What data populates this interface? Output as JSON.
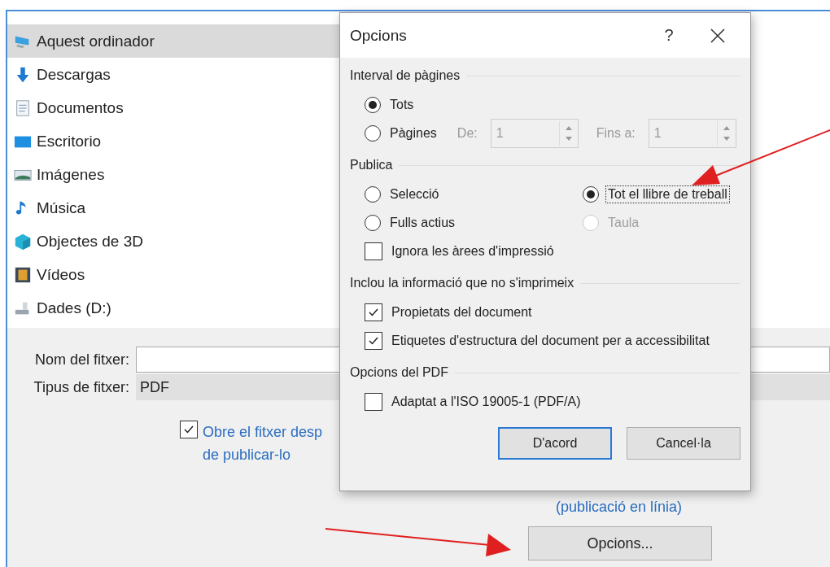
{
  "sidebar": {
    "items": [
      {
        "label": "Aquest ordinador",
        "selected": true
      },
      {
        "label": "Descargas",
        "selected": false
      },
      {
        "label": "Documentos",
        "selected": false
      },
      {
        "label": "Escritorio",
        "selected": false
      },
      {
        "label": "Imágenes",
        "selected": false
      },
      {
        "label": "Música",
        "selected": false
      },
      {
        "label": "Objectes de 3D",
        "selected": false
      },
      {
        "label": "Vídeos",
        "selected": false
      },
      {
        "label": "Dades (D:)",
        "selected": false
      }
    ]
  },
  "save_form": {
    "file_name": {
      "label": "Nom del fitxer:"
    },
    "file_type": {
      "label": "Tipus de fitxer:",
      "value": "PDF"
    },
    "open_after": {
      "lines": [
        "Obre el fitxer desp",
        "de publicar-lo"
      ],
      "checked": true
    },
    "optimize_note": "(publicació en línia)",
    "options_button": "Opcions..."
  },
  "dialog": {
    "title": "Opcions",
    "help": "?",
    "page_range": {
      "title": "Interval de pàgines",
      "options": [
        {
          "label": "Tots",
          "selected": true
        },
        {
          "label": "Pàgines",
          "selected": false
        }
      ],
      "from": {
        "label": "De:",
        "value": "1",
        "disabled": true
      },
      "to": {
        "label": "Fins a:",
        "value": "1",
        "disabled": true
      }
    },
    "publish": {
      "title": "Publica",
      "options": [
        {
          "label": "Selecció",
          "selected": false,
          "disabled": false,
          "focused": false
        },
        {
          "label": "Tot el llibre de treball",
          "selected": true,
          "disabled": false,
          "focused": true
        },
        {
          "label": "Fulls actius",
          "selected": false,
          "disabled": false,
          "focused": false
        },
        {
          "label": "Taula",
          "selected": false,
          "disabled": true,
          "focused": false
        }
      ],
      "ignore_print_areas": {
        "label": "Ignora les àrees d'impressió",
        "checked": false
      }
    },
    "non_printing": {
      "title": "Inclou la informació que no s'imprimeix",
      "checks": [
        {
          "label": "Propietats del document",
          "checked": true
        },
        {
          "label": "Etiquetes d'estructura del document per a accessibilitat",
          "checked": true
        }
      ]
    },
    "pdf_options": {
      "title": "Opcions del PDF",
      "checks": [
        {
          "label": "Adaptat a l'ISO 19005-1 (PDF/A)",
          "checked": false
        }
      ]
    },
    "buttons": [
      {
        "label": "D'acord",
        "default": true
      },
      {
        "label": "Cancel·la",
        "default": false
      }
    ]
  }
}
